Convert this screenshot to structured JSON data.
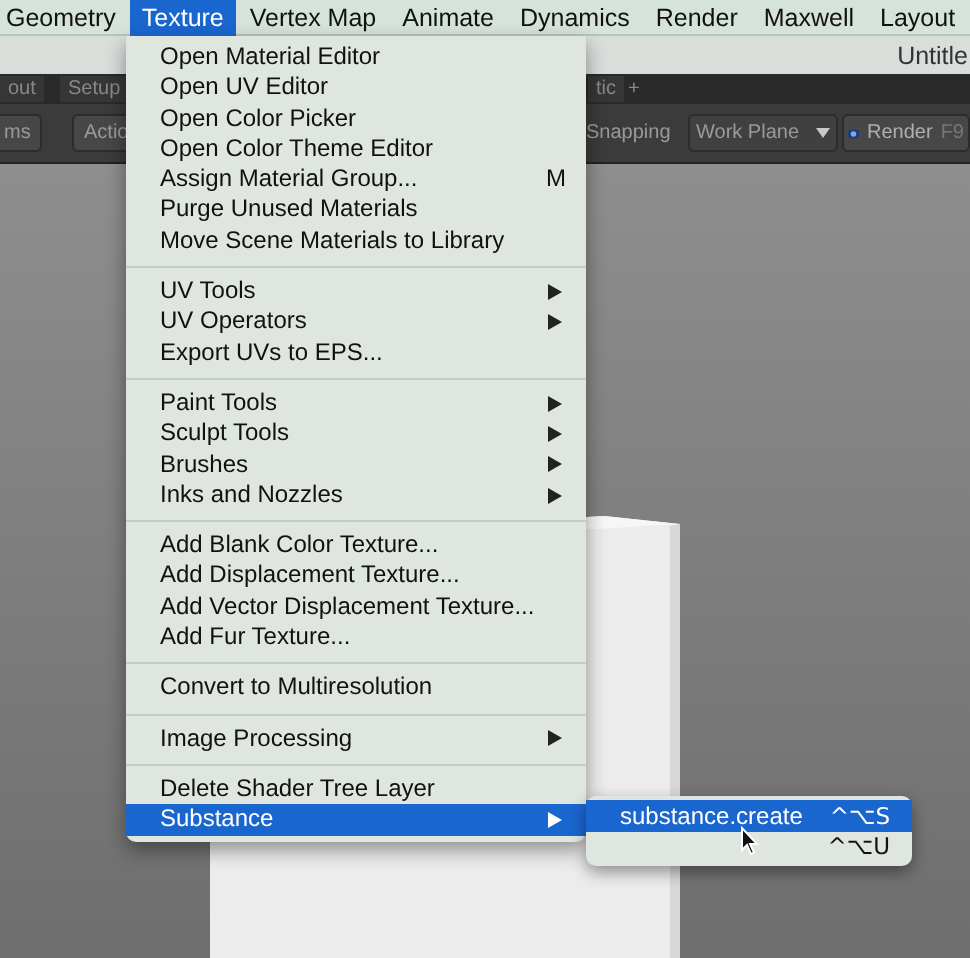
{
  "menu_bar": {
    "items": [
      {
        "label": "Geometry",
        "selected": false
      },
      {
        "label": "Texture",
        "selected": true
      },
      {
        "label": "Vertex Map",
        "selected": false
      },
      {
        "label": "Animate",
        "selected": false
      },
      {
        "label": "Dynamics",
        "selected": false
      },
      {
        "label": "Render",
        "selected": false
      },
      {
        "label": "Maxwell",
        "selected": false
      },
      {
        "label": "Layout",
        "selected": false
      }
    ]
  },
  "title_bar": {
    "title": "Untitle"
  },
  "tabs": {
    "items": [
      {
        "label": "out"
      },
      {
        "label": "Setup"
      },
      {
        "label": "tic"
      }
    ],
    "add": "+"
  },
  "toolbar": {
    "left": [
      {
        "label": "ms"
      },
      {
        "label": "Actio"
      }
    ],
    "snapping": "Snapping",
    "work_plane": "Work Plane",
    "render": {
      "label": "Render",
      "shortcut": "F9"
    }
  },
  "menu": {
    "groups": [
      [
        {
          "label": "Open Material Editor",
          "submenu": false,
          "selected": false
        },
        {
          "label": "Open UV Editor",
          "submenu": false,
          "selected": false
        },
        {
          "label": "Open Color Picker",
          "submenu": false,
          "selected": false
        },
        {
          "label": "Open Color Theme Editor",
          "submenu": false,
          "selected": false
        },
        {
          "label": "Assign Material Group...",
          "shortcut": "M",
          "submenu": false,
          "selected": false
        },
        {
          "label": "Purge Unused Materials",
          "submenu": false,
          "selected": false
        },
        {
          "label": "Move Scene Materials to Library",
          "submenu": false,
          "selected": false
        }
      ],
      [
        {
          "label": "UV Tools",
          "submenu": true,
          "selected": false
        },
        {
          "label": "UV Operators",
          "submenu": true,
          "selected": false
        },
        {
          "label": "Export UVs to EPS...",
          "submenu": false,
          "selected": false
        }
      ],
      [
        {
          "label": "Paint Tools",
          "submenu": true,
          "selected": false
        },
        {
          "label": "Sculpt Tools",
          "submenu": true,
          "selected": false
        },
        {
          "label": "Brushes",
          "submenu": true,
          "selected": false
        },
        {
          "label": "Inks and Nozzles",
          "submenu": true,
          "selected": false
        }
      ],
      [
        {
          "label": "Add Blank Color Texture...",
          "submenu": false,
          "selected": false
        },
        {
          "label": "Add Displacement Texture...",
          "submenu": false,
          "selected": false
        },
        {
          "label": "Add Vector Displacement Texture...",
          "submenu": false,
          "selected": false
        },
        {
          "label": "Add Fur Texture...",
          "submenu": false,
          "selected": false
        }
      ],
      [
        {
          "label": "Convert to Multiresolution",
          "submenu": false,
          "selected": false
        }
      ],
      [
        {
          "label": "Image Processing",
          "submenu": true,
          "selected": false
        }
      ],
      [
        {
          "label": "Delete Shader Tree Layer",
          "submenu": false,
          "selected": false
        },
        {
          "label": "Substance",
          "submenu": true,
          "selected": true
        }
      ]
    ]
  },
  "submenu": {
    "items": [
      {
        "label": "substance.create",
        "shortcut": "^⌥S",
        "selected": true
      },
      {
        "shortcut": "^⌥U",
        "selected": false
      }
    ]
  }
}
